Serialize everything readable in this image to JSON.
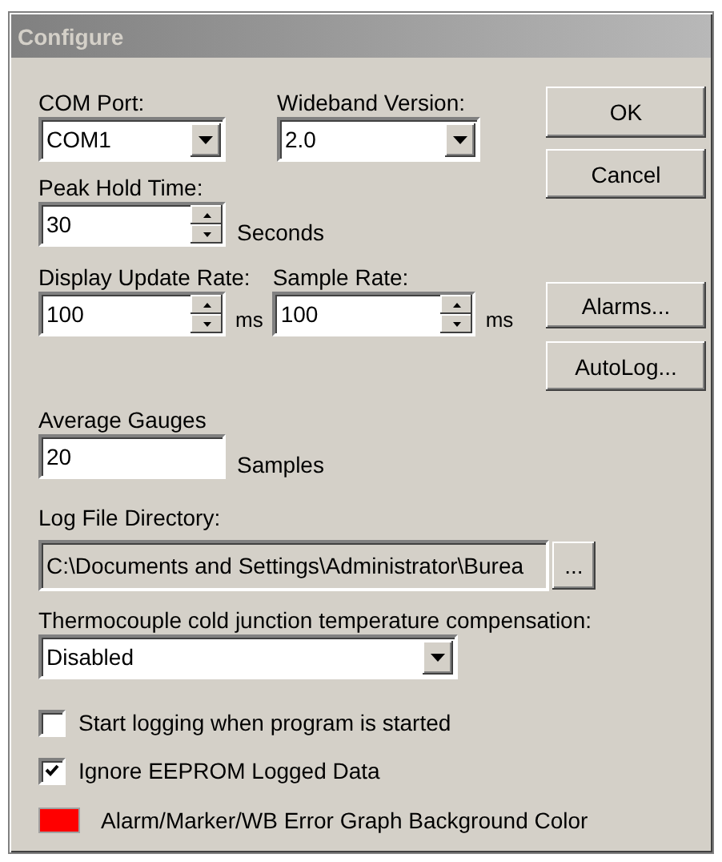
{
  "window": {
    "title": "Configure"
  },
  "com_port": {
    "label": "COM Port:",
    "value": "COM1"
  },
  "wideband_version": {
    "label": "Wideband Version:",
    "value": "2.0"
  },
  "peak_hold_time": {
    "label": "Peak Hold Time:",
    "value": "30",
    "unit": "Seconds"
  },
  "display_update_rate": {
    "label": "Display Update Rate:",
    "value": "100",
    "unit": "ms"
  },
  "sample_rate": {
    "label": "Sample Rate:",
    "value": "100",
    "unit": "ms"
  },
  "average_gauges": {
    "label": "Average Gauges",
    "value": "20",
    "unit": "Samples"
  },
  "log_file_directory": {
    "label": "Log File Directory:",
    "value": "C:\\Documents and Settings\\Administrator\\Burea",
    "disabled": true,
    "browse_button": "..."
  },
  "thermocouple_compensation": {
    "label": "Thermocouple cold junction temperature compensation:",
    "value": "Disabled"
  },
  "checkboxes": [
    {
      "label": "Start logging when program is started",
      "checked": false
    },
    {
      "label": "Ignore EEPROM Logged Data",
      "checked": true
    }
  ],
  "color_setting": {
    "label": "Alarm/Marker/WB Error Graph Background Color",
    "color": "#ff0000"
  },
  "buttons": [
    {
      "label": "OK"
    },
    {
      "label": "Cancel"
    },
    {
      "label": "Alarms..."
    },
    {
      "label": "AutoLog..."
    }
  ]
}
